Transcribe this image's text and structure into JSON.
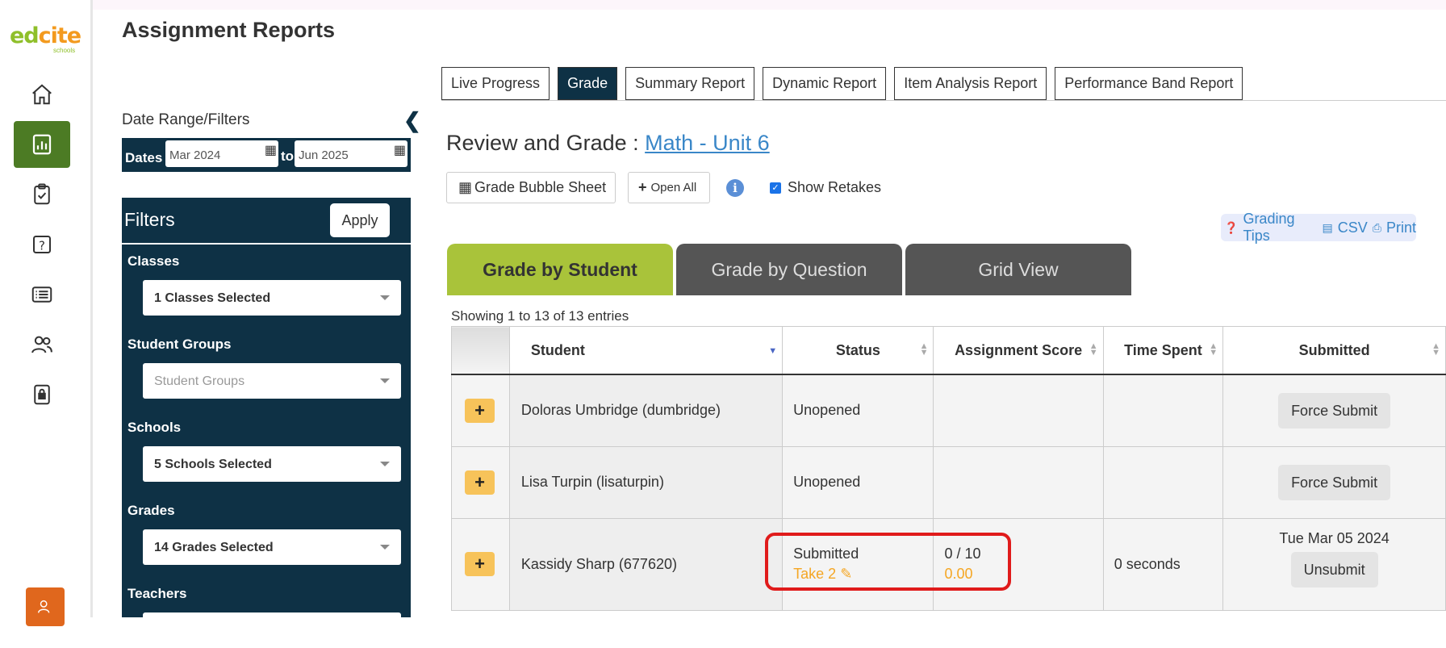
{
  "page_title": "Assignment Reports",
  "logo": {
    "word_main": "edcite",
    "sub": "schools"
  },
  "nav": {
    "icons": [
      "home-icon",
      "reports-icon",
      "assignments-icon",
      "questions-icon",
      "list-icon",
      "users-icon",
      "lock-icon",
      "teacher-settings-icon"
    ]
  },
  "report_tabs": [
    "Live Progress",
    "Grade",
    "Summary Report",
    "Dynamic Report",
    "Item Analysis Report",
    "Performance Band Report"
  ],
  "sidebar": {
    "date_range_title": "Date Range/Filters",
    "dates_label": "Dates",
    "date_from": "Mar 2024",
    "to_label": "to",
    "date_to": "Jun 2025",
    "filters_title": "Filters",
    "apply_label": "Apply",
    "filters": [
      {
        "label": "Classes",
        "value": "1 Classes Selected",
        "placeholder": false
      },
      {
        "label": "Student Groups",
        "value": "Student Groups",
        "placeholder": true
      },
      {
        "label": "Schools",
        "value": "5 Schools Selected",
        "placeholder": false
      },
      {
        "label": "Grades",
        "value": "14 Grades Selected",
        "placeholder": false
      },
      {
        "label": "Teachers",
        "value": "",
        "placeholder": false
      }
    ]
  },
  "main": {
    "review_label": "Review and Grade :",
    "assignment_link": "Math - Unit 6",
    "bubble_sheet_label": "Grade Bubble Sheet",
    "open_all_label": "Open All",
    "show_retakes_label": "Show Retakes",
    "grading_tips_label": "Grading Tips",
    "csv_label": "CSV",
    "print_label": "Print",
    "grade_tabs": [
      "Grade by Student",
      "Grade by Question",
      "Grid View"
    ],
    "entries_text": "Showing 1 to 13 of 13 entries",
    "columns": [
      "",
      "Student",
      "Status",
      "Assignment Score",
      "Time Spent",
      "Submitted"
    ],
    "rows": [
      {
        "student": "Doloras Umbridge (dumbridge)",
        "status": "Unopened",
        "take": "",
        "score": "",
        "score2": "",
        "time": "",
        "date": "",
        "action": "Force Submit"
      },
      {
        "student": "Lisa Turpin (lisaturpin)",
        "status": "Unopened",
        "take": "",
        "score": "",
        "score2": "",
        "time": "",
        "date": "",
        "action": "Force Submit"
      },
      {
        "student": "Kassidy Sharp (677620)",
        "status": "Submitted",
        "take": "Take 2",
        "score": "0 / 10",
        "score2": "0.00",
        "time": "0 seconds",
        "date": "Tue Mar 05 2024",
        "action": "Unsubmit"
      }
    ]
  },
  "colors": {
    "navy": "#0e3145",
    "green_active": "#4c7b24",
    "tab_green": "#a9c33a",
    "highlight": "#e01b1b",
    "orange": "#f5a623"
  }
}
